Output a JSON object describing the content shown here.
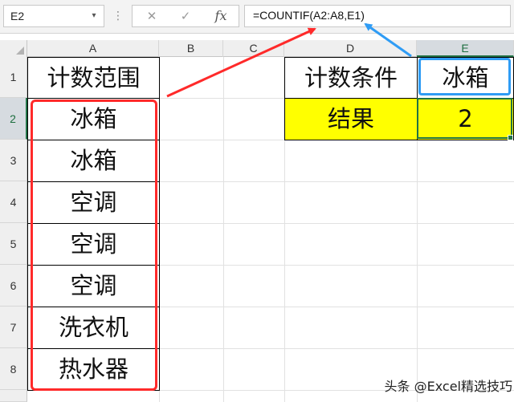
{
  "name_box": {
    "value": "E2",
    "dropdown_icon": "chevron-down-icon"
  },
  "formula_bar": {
    "separator_icon": "vertical-dots-icon",
    "cancel_icon": "x-icon",
    "enter_icon": "check-icon",
    "fx_label": "fx",
    "formula": "=COUNTIF(A2:A8,E1)"
  },
  "columns": [
    "A",
    "B",
    "C",
    "D",
    "E"
  ],
  "rows": [
    "1",
    "2",
    "3",
    "4",
    "5",
    "6",
    "7",
    "8"
  ],
  "cells": {
    "A1": "计数范围",
    "A2": "冰箱",
    "A3": "冰箱",
    "A4": "空调",
    "A5": "空调",
    "A6": "空调",
    "A7": "洗衣机",
    "A8": "热水器",
    "D1": "计数条件",
    "E1": "冰箱",
    "D2": "结果",
    "E2": "2"
  },
  "colors": {
    "highlight_fill": "#ffff00",
    "range_annotation": "#ff2a2a",
    "criteria_annotation": "#2f9cf5",
    "selection": "#217346"
  },
  "watermark": "头条 @Excel精选技巧"
}
